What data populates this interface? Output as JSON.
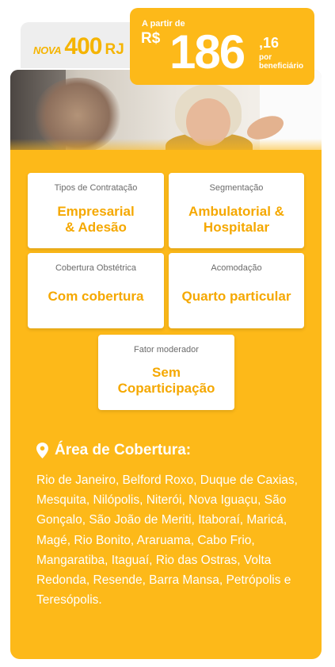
{
  "plan": {
    "prefix": "NOVA",
    "number": "400",
    "suffix": "RJ"
  },
  "price": {
    "from_label": "A partir de",
    "currency": "R$",
    "value": "186",
    "cents": ",16",
    "per_label": "por beneficiário"
  },
  "features": [
    {
      "label": "Tipos de Contratação",
      "value_line1": "Empresarial",
      "value_line2": "& Adesão"
    },
    {
      "label": "Segmentação",
      "value_line1": "Ambulatorial &",
      "value_line2": "Hospitalar"
    },
    {
      "label": "Cobertura Obstétrica",
      "value_line1": "Com cobertura"
    },
    {
      "label": "Acomodação",
      "value_line1": "Quarto particular"
    },
    {
      "label": "Fator moderador",
      "value_line1": "Sem",
      "value_line2": "Coparticipação"
    }
  ],
  "coverage": {
    "title": "Área de Cobertura:",
    "icon": "location-pin-icon",
    "text": "Rio de Janeiro, Belford Roxo, Duque de Caxias, Mesquita, Nilópolis, Niterói, Nova Iguaçu, São Gonçalo, São João de Meriti, Itaboraí, Maricá, Magé, Rio Bonito, Araruama, Cabo Frio, Mangaratiba, Itaguaí, Rio das Ostras, Volta Redonda, Resende, Barra Mansa, Petrópolis e Teresópolis."
  },
  "colors": {
    "accent": "#fdb919",
    "accent_text": "#f5a800",
    "label_gray": "#6b6b6b",
    "tab_bg": "#eeeeee"
  }
}
